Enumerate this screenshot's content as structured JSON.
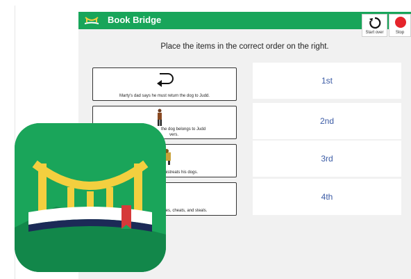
{
  "app": {
    "title": "Book Bridge",
    "start_over_label": "Start over",
    "stop_label": "Stop",
    "instruction": "Place the items in the correct order on the right."
  },
  "cards": [
    {
      "caption": "Marty's dad says he must return the dog to Judd.",
      "icon": "return-arrow-icon"
    },
    {
      "caption": "the dog belongs to Judd",
      "caption2": "vers.",
      "icon": "person-figure-icon"
    },
    {
      "caption": "d mistreats his dogs.",
      "icon": "dog-picture-icon"
    },
    {
      "caption": "lies, cheats, and steals.",
      "icon": "person-figure-icon"
    }
  ],
  "slots": [
    "1st",
    "2nd",
    "3rd",
    "4th"
  ],
  "colors": {
    "brand_green": "#18a55a",
    "slot_text": "#3b5ba5",
    "stop_red": "#e5242b"
  }
}
